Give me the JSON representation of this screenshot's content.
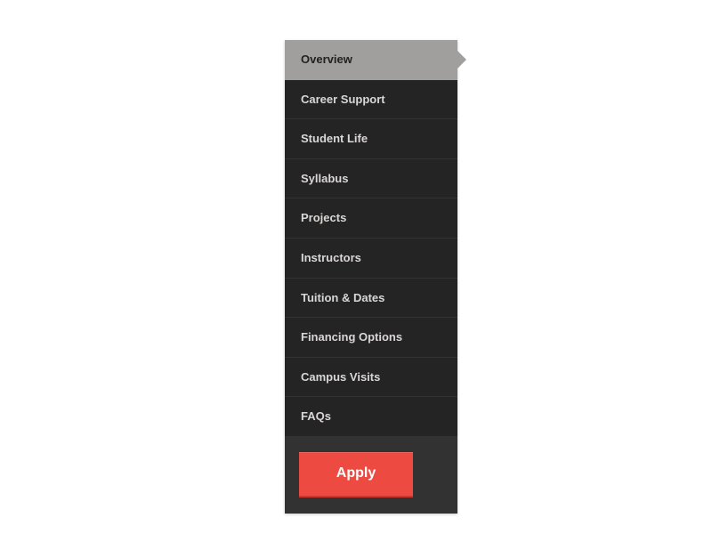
{
  "sidebar": {
    "items": [
      {
        "label": "Overview",
        "active": true
      },
      {
        "label": "Career Support",
        "active": false
      },
      {
        "label": "Student Life",
        "active": false
      },
      {
        "label": "Syllabus",
        "active": false
      },
      {
        "label": "Projects",
        "active": false
      },
      {
        "label": "Instructors",
        "active": false
      },
      {
        "label": "Tuition & Dates",
        "active": false
      },
      {
        "label": "Financing Options",
        "active": false
      },
      {
        "label": "Campus Visits",
        "active": false
      },
      {
        "label": "FAQs",
        "active": false
      }
    ],
    "apply_label": "Apply"
  },
  "colors": {
    "sidebar_bg": "#333232",
    "list_bg": "#252424",
    "item_text": "#d9d7d6",
    "active_bg": "#a09f9e",
    "active_text": "#222121",
    "apply_bg": "#ed4a41",
    "apply_text": "#ffffff"
  }
}
